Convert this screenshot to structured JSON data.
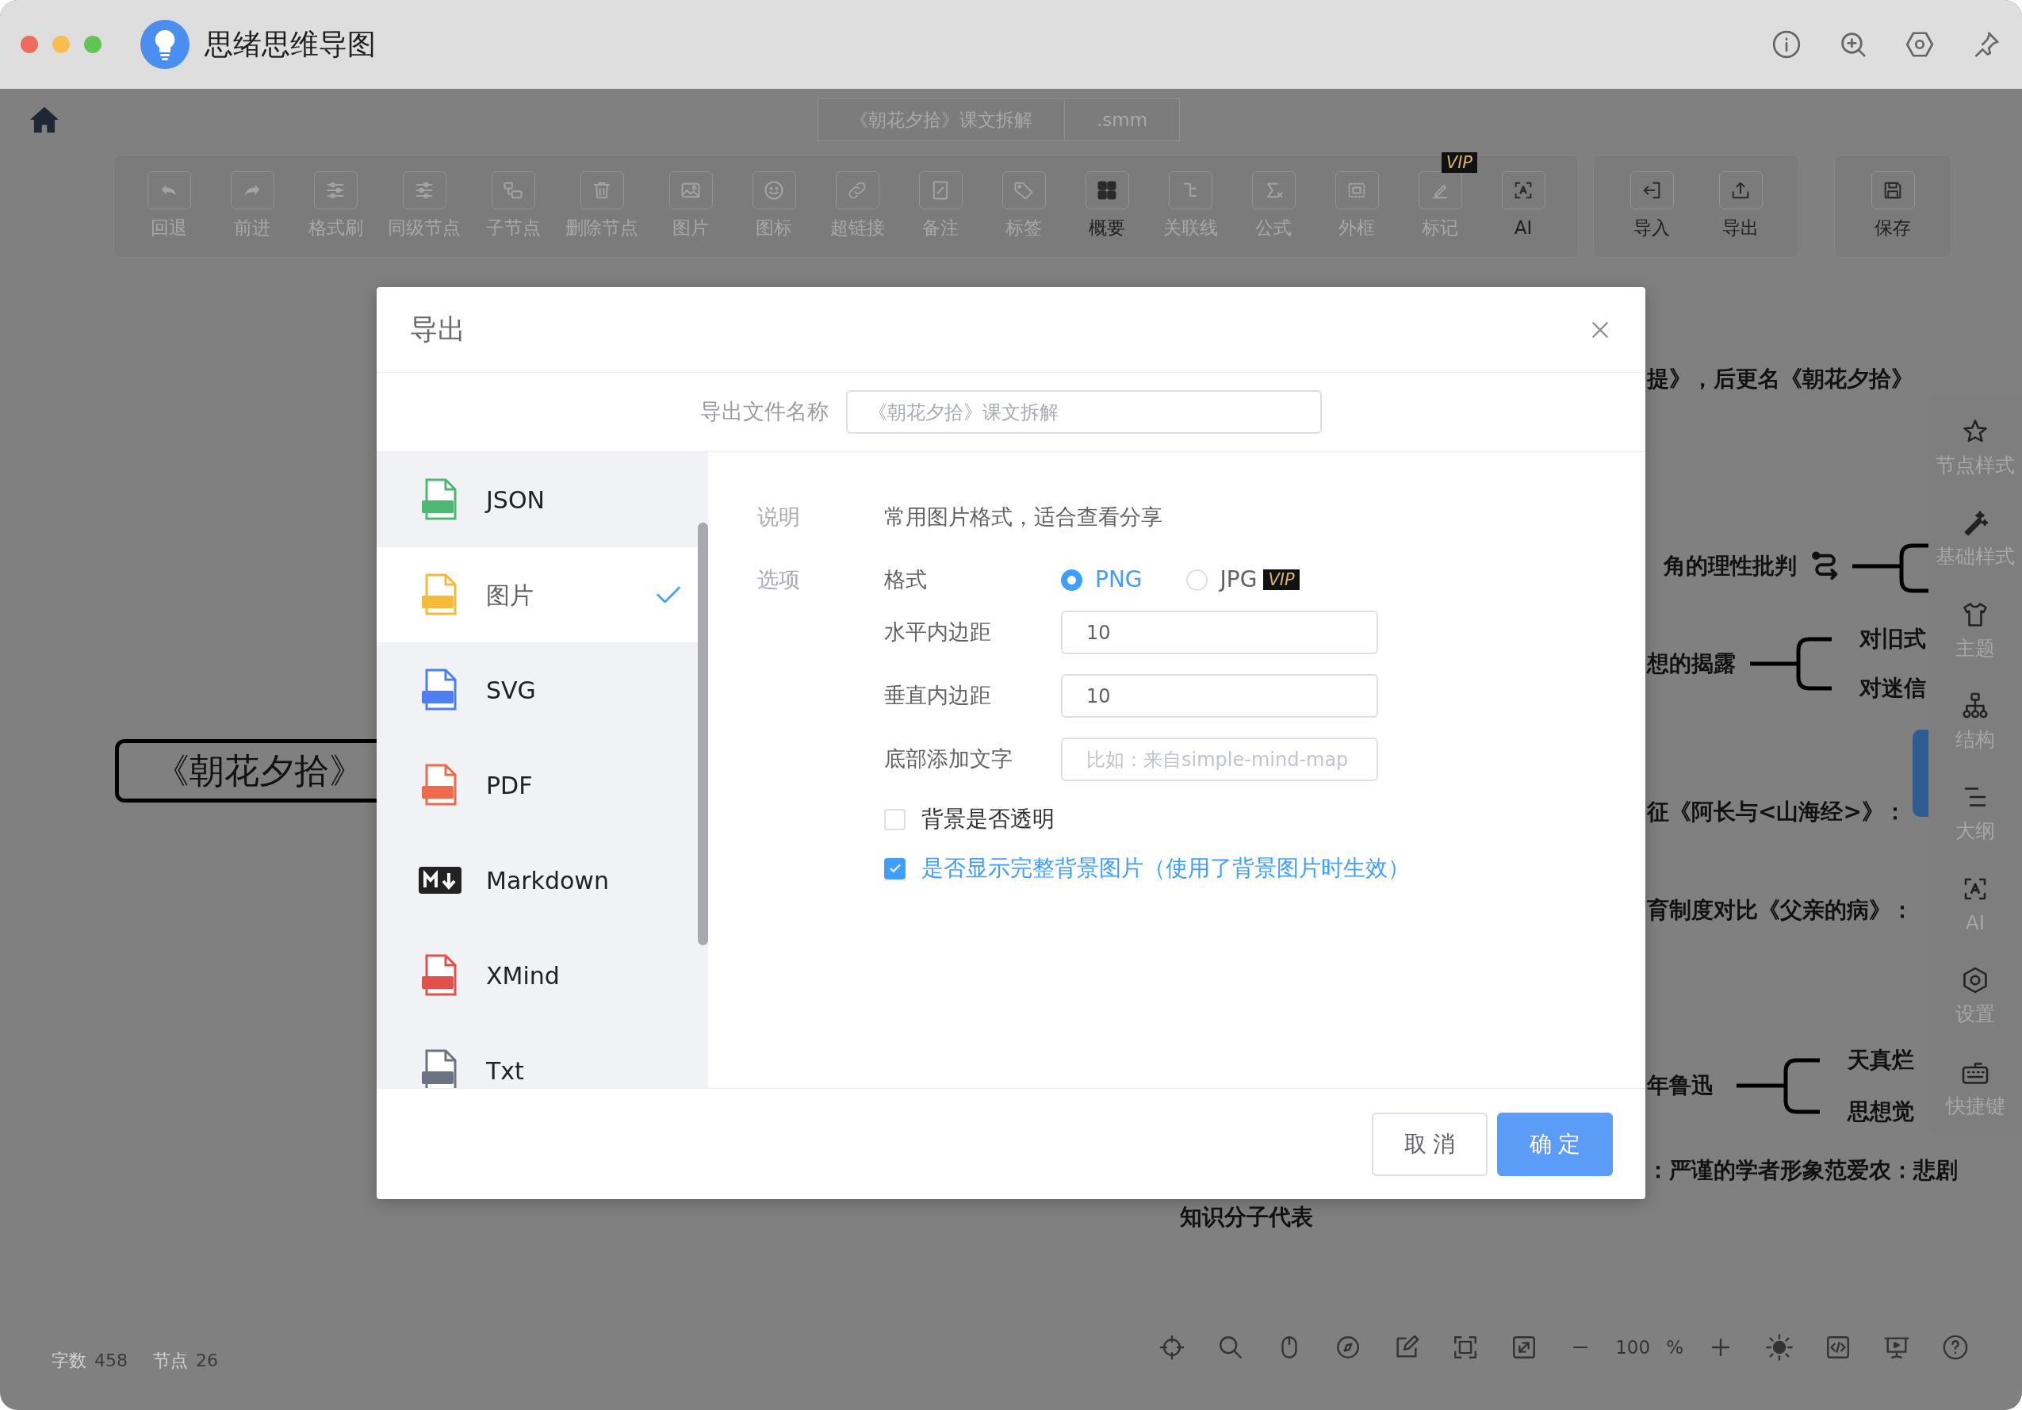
{
  "window": {
    "title": "思绪思维导图"
  },
  "file_tabs": [
    {
      "label": "《朝花夕拾》课文拆解"
    },
    {
      "label": ".smm"
    }
  ],
  "toolbar": [
    {
      "label": "回退",
      "disabled": true
    },
    {
      "label": "前进",
      "disabled": true
    },
    {
      "label": "格式刷",
      "disabled": true
    },
    {
      "label": "同级节点",
      "disabled": true
    },
    {
      "label": "子节点",
      "disabled": true
    },
    {
      "label": "删除节点",
      "disabled": true
    },
    {
      "label": "图片",
      "disabled": true
    },
    {
      "label": "图标",
      "disabled": true
    },
    {
      "label": "超链接",
      "disabled": true
    },
    {
      "label": "备注",
      "disabled": true
    },
    {
      "label": "标签",
      "disabled": true
    },
    {
      "label": "概要",
      "disabled": false
    },
    {
      "label": "关联线",
      "disabled": true
    },
    {
      "label": "公式",
      "disabled": true
    },
    {
      "label": "外框",
      "disabled": true
    },
    {
      "label": "标记",
      "disabled": true,
      "badge": "VIP"
    },
    {
      "label": "AI",
      "disabled": false
    }
  ],
  "toolbar_io": [
    {
      "label": "导入",
      "disabled": false
    },
    {
      "label": "导出",
      "disabled": false
    }
  ],
  "save": {
    "label": "保存"
  },
  "mind_map": {
    "root": {
      "text": "《朝花夕拾》"
    },
    "nodes": [
      {
        "text": "提》，后更名《朝花夕拾》",
        "linked": false,
        "branch": false
      },
      {
        "text": "角的理性批判",
        "linked": true,
        "branch": true
      },
      {
        "text": "想的揭露",
        "linked": false,
        "branch": true,
        "children": [
          {
            "text": "对旧式"
          },
          {
            "text": "对迷信"
          }
        ]
      },
      {
        "text": "征《阿长与<山海经>》：",
        "linked": false,
        "branch": false
      },
      {
        "text": "育制度对比《父亲的病》：",
        "linked": false,
        "branch": false
      },
      {
        "text": "年鲁迅",
        "linked": false,
        "branch": true,
        "children": [
          {
            "text": "天真烂"
          },
          {
            "text": "思想觉"
          }
        ]
      },
      {
        "text": "：严谨的学者形象范爱农：悲剧",
        "linked": false,
        "branch": false
      },
      {
        "text": "知识分子代表",
        "linked": false,
        "branch": false
      }
    ]
  },
  "right_panel": {
    "items": [
      {
        "label": "节点样式"
      },
      {
        "label": "基础样式"
      },
      {
        "label": "主题"
      },
      {
        "label": "结构"
      },
      {
        "label": "大纲"
      },
      {
        "label": "AI"
      },
      {
        "label": "设置"
      },
      {
        "label": "快捷键"
      }
    ]
  },
  "status": {
    "words_label": "字数",
    "words": "458",
    "nodes_label": "节点",
    "nodes": "26"
  },
  "zoom": {
    "value": "100",
    "unit": "%"
  },
  "dialog": {
    "title": "导出",
    "filename": {
      "label": "导出文件名称",
      "placeholder": "《朝花夕拾》课文拆解"
    },
    "formats": [
      {
        "label": "JSON",
        "kind": "file",
        "color": "#4cb873",
        "selected": false
      },
      {
        "label": "图片",
        "kind": "file",
        "color": "#f5b93c",
        "selected": true
      },
      {
        "label": "SVG",
        "kind": "file",
        "color": "#4d7ff0",
        "selected": false
      },
      {
        "label": "PDF",
        "kind": "file",
        "color": "#ef6a4d",
        "selected": false
      },
      {
        "label": "Markdown",
        "kind": "badge",
        "color": "#222222",
        "selected": false
      },
      {
        "label": "XMind",
        "kind": "file",
        "color": "#e2504c",
        "selected": false
      },
      {
        "label": "Txt",
        "kind": "file",
        "color": "#6b7280",
        "selected": false
      }
    ],
    "description": {
      "label": "说明",
      "text": "常用图片格式，适合查看分享"
    },
    "options": {
      "label": "选项",
      "format": {
        "label": "格式",
        "choices": [
          {
            "label": "PNG",
            "selected": true
          },
          {
            "label": "JPG",
            "selected": false,
            "badge": "VIP"
          }
        ]
      },
      "fields": [
        {
          "label": "水平内边距",
          "value": "10"
        },
        {
          "label": "垂直内边距",
          "value": "10"
        },
        {
          "label": "底部添加文字",
          "placeholder": "比如：来自simple-mind-map"
        }
      ],
      "checks": [
        {
          "label": "背景是否透明",
          "checked": false
        },
        {
          "label": "是否显示完整背景图片（使用了背景图片时生效）",
          "checked": true
        }
      ]
    },
    "buttons": [
      {
        "label": "取 消",
        "kind": "secondary"
      },
      {
        "label": "确 定",
        "kind": "primary"
      }
    ]
  }
}
